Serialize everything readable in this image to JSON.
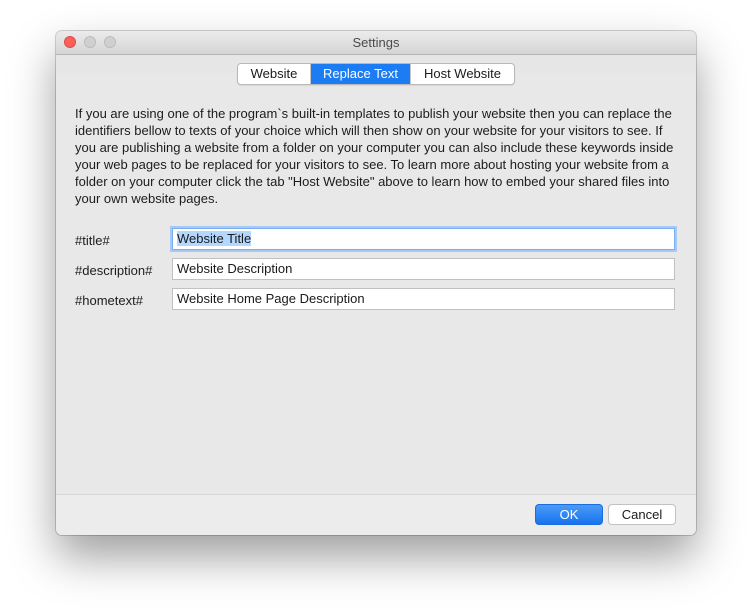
{
  "window": {
    "title": "Settings"
  },
  "tabs": [
    {
      "label": "Website",
      "selected": false
    },
    {
      "label": "Replace Text",
      "selected": true
    },
    {
      "label": "Host Website",
      "selected": false
    }
  ],
  "description": "If you are using one of the program`s built-in templates to publish your website then you can replace the identifiers bellow to texts of your choice which will then show on your website for your visitors to see. If you are publishing a website from a folder on your computer you can also include these keywords inside your web pages to be replaced for your visitors to see. To learn more about hosting your website from a folder on your computer click the tab \"Host Website\" above to learn how to embed your shared files into your own website pages.",
  "fields": [
    {
      "label": "#title#",
      "value": "Website Title"
    },
    {
      "label": "#description#",
      "value": "Website Description"
    },
    {
      "label": "#hometext#",
      "value": "Website Home Page Description"
    }
  ],
  "buttons": {
    "ok": "OK",
    "cancel": "Cancel"
  },
  "colors": {
    "accent": "#1b7cf3",
    "close": "#fc605c"
  }
}
